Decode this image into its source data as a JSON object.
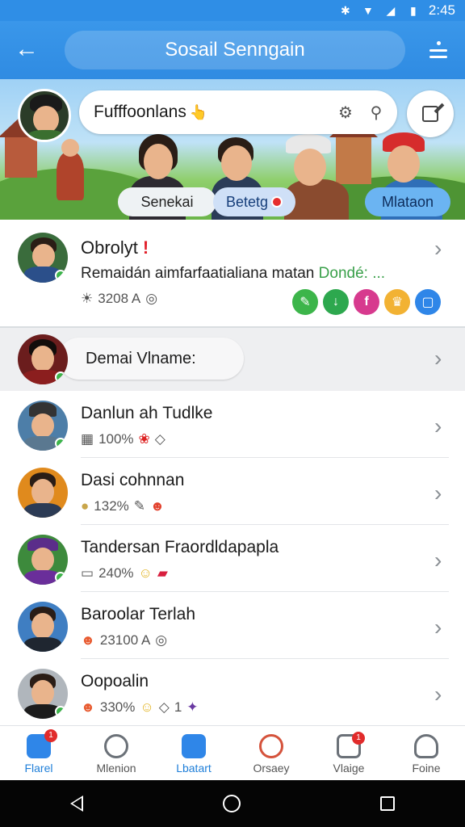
{
  "status_bar": {
    "time": "2:45",
    "icons": [
      "bluetooth-icon",
      "wifi-icon",
      "signal-icon",
      "battery-icon"
    ]
  },
  "app_bar": {
    "title": "Sosail Senngain",
    "back_icon": "arrow-left-icon",
    "menu_icon": "more-vertical-icon"
  },
  "banner": {
    "composer_text": "Fufffoonlans",
    "composer_emoji": "👆",
    "chips": [
      {
        "label": "Senekai"
      },
      {
        "label": "Betetg"
      },
      {
        "label": "Mlataon"
      }
    ]
  },
  "featured": {
    "name": "Obrolyt",
    "name_mark": "!",
    "description": "Remaidán aimfarfaatialiana matan ",
    "description_tail": "Dondé: ...",
    "meta_text": "3208 A",
    "reactions": [
      {
        "icon": "leaf-icon",
        "color": "#3cb54a"
      },
      {
        "icon": "download-icon",
        "color": "#2da84e"
      },
      {
        "icon": "facebook-icon",
        "color": "#d73a8e"
      },
      {
        "icon": "crown-icon",
        "color": "#f2b233"
      },
      {
        "icon": "square-icon",
        "color": "#2f86e8"
      }
    ]
  },
  "section": {
    "label": "Demai Vlname:"
  },
  "contacts": [
    {
      "name": "Danlun ah Tudlke",
      "meta": "100%",
      "avatar_bg": "#4d7ea8"
    },
    {
      "name": "Dasi cohnnan",
      "meta": "132%",
      "avatar_bg": "#e08a1d"
    },
    {
      "name": "Tandersan Fraordldapapla",
      "meta": "240%",
      "avatar_bg": "#3d8a3c"
    },
    {
      "name": "Baroolar Terlah",
      "meta": "23100 A",
      "avatar_bg": "#3f7ec2"
    },
    {
      "name": "Oopoalin",
      "meta": "330%",
      "meta_tail": "1",
      "avatar_bg": "#b0b6bc"
    }
  ],
  "bottom_nav": [
    {
      "label": "Flarel",
      "icon": "home-icon",
      "color": "#2f86e8",
      "badge": "1"
    },
    {
      "label": "Mlenion",
      "icon": "mention-icon",
      "color": "#6b7178",
      "badge": ""
    },
    {
      "label": "Lbatart",
      "icon": "contacts-icon",
      "color": "#2f86e8",
      "badge": ""
    },
    {
      "label": "Orsaey",
      "icon": "heart-icon",
      "color": "#d5533c",
      "badge": ""
    },
    {
      "label": "Vlaige",
      "icon": "camera-icon",
      "color": "#6b7178",
      "badge": "1"
    },
    {
      "label": "Foine",
      "icon": "profile-icon",
      "color": "#6b7178",
      "badge": ""
    }
  ]
}
